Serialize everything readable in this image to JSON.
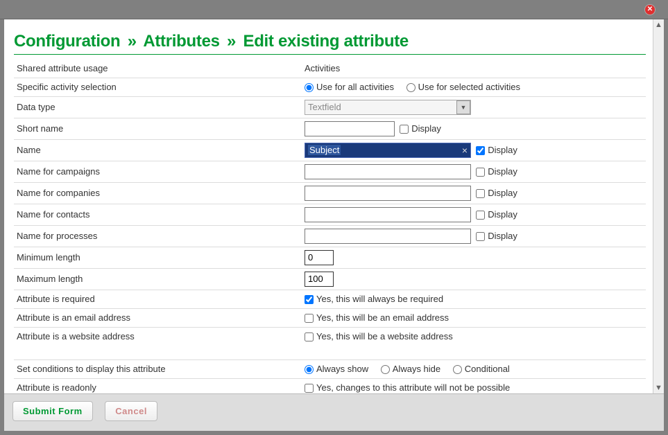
{
  "breadcrumb": {
    "a": "Configuration",
    "b": "Attributes",
    "c": "Edit existing attribute",
    "sep": "»"
  },
  "labels": {
    "shared_usage": "Shared attribute usage",
    "activities": "Activities",
    "activity_selection": "Specific activity selection",
    "use_all": "Use for all activities",
    "use_selected": "Use for selected activities",
    "data_type": "Data type",
    "short_name": "Short name",
    "name": "Name",
    "name_campaigns": "Name for campaigns",
    "name_companies": "Name for companies",
    "name_contacts": "Name for contacts",
    "name_processes": "Name for processes",
    "min_length": "Minimum length",
    "max_length": "Maximum length",
    "required": "Attribute is required",
    "required_yes": "Yes, this will always be required",
    "is_email": "Attribute is an email address",
    "is_email_yes": "Yes, this will be an email address",
    "is_website": "Attribute is a website address",
    "is_website_yes": "Yes, this will be a website address",
    "conditions": "Set conditions to display this attribute",
    "always_show": "Always show",
    "always_hide": "Always hide",
    "conditional": "Conditional",
    "readonly": "Attribute is readonly",
    "readonly_yes": "Yes, changes to this attribute will not be possible",
    "display": "Display"
  },
  "values": {
    "data_type": "Textfield",
    "short_name": "",
    "name": "Subject",
    "name_campaigns": "",
    "name_companies": "",
    "name_contacts": "",
    "name_processes": "",
    "min_length": "0",
    "max_length": "100"
  },
  "checks": {
    "display_short_name": false,
    "display_name": true,
    "display_campaigns": false,
    "display_companies": false,
    "display_contacts": false,
    "display_processes": false,
    "required": true,
    "is_email": false,
    "is_website": false,
    "readonly": false
  },
  "radios": {
    "activity": "all",
    "conditions": "always_show"
  },
  "footer": {
    "submit": "Submit Form",
    "cancel": "Cancel"
  }
}
